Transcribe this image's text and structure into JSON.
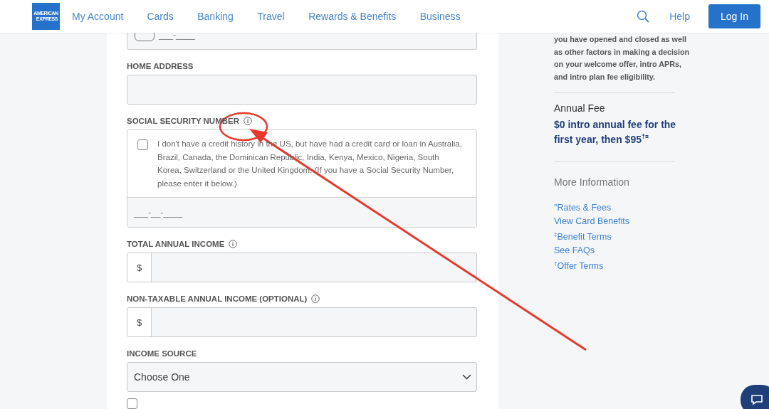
{
  "header": {
    "logo": {
      "line_1": "AMERICAN",
      "line_2": "EXPRESS"
    },
    "nav": [
      {
        "label": "My Account"
      },
      {
        "label": "Cards"
      },
      {
        "label": "Banking"
      },
      {
        "label": "Travel"
      },
      {
        "label": "Rewards & Benefits"
      },
      {
        "label": "Business"
      }
    ],
    "help": "Help",
    "login": "Log In"
  },
  "form": {
    "phone": {
      "placeholder": "___-____"
    },
    "fields": [
      {
        "kind": "text",
        "label": "HOME ADDRESS",
        "info": false
      },
      {
        "kind": "ssn",
        "label": "SOCIAL SECURITY NUMBER",
        "info": true,
        "checkbox": {
          "checked": false,
          "text": "I don't have a credit history in the US, but have had a credit card or loan in Australia, Brazil, Canada, the Dominican Republic, India, Kenya, Mexico, Nigeria, South Korea, Switzerland or the United Kingdom. (If you have a Social Security Number, please enter it below.)"
        },
        "placeholder": "___-__-____"
      },
      {
        "kind": "currency",
        "label": "TOTAL ANNUAL INCOME",
        "info": true,
        "prefix": "$"
      },
      {
        "kind": "currency",
        "label": "NON-TAXABLE ANNUAL INCOME (OPTIONAL)",
        "info": true,
        "prefix": "$"
      },
      {
        "kind": "select",
        "label": "INCOME SOURCE",
        "info": false,
        "value": "Choose One"
      }
    ],
    "trailing_checkbox": {
      "checked": false
    }
  },
  "sidebar": {
    "note": "you have opened and closed as well as other factors in making a decision on your welcome offer, intro APRs, and intro plan fee eligibility.",
    "fee_title": "Annual Fee",
    "fee_text": "$0 intro annual fee for the first year, then $95$^{†¤}$",
    "more_title": "More Information",
    "links": [
      {
        "label": "$^{¤}$Rates & Fees"
      },
      {
        "label": "View Card Benefits"
      },
      {
        "label": "$^{‡}$Benefit Terms"
      },
      {
        "label": "See FAQs"
      },
      {
        "label": "$^{†}$Offer Terms"
      }
    ]
  }
}
